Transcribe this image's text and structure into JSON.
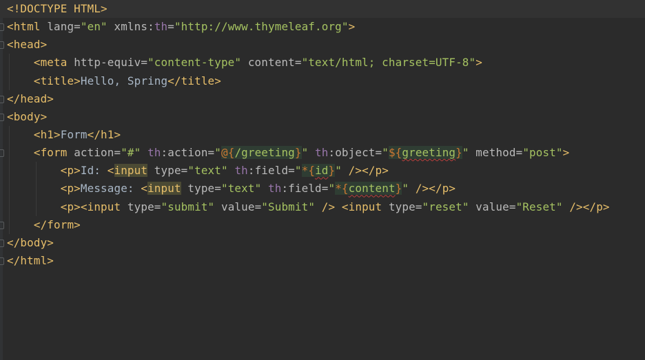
{
  "editor": {
    "lines": [
      {
        "indent": 0,
        "fold": false,
        "tokens": [
          [
            "<!DOCTYPE HTML>",
            "tag"
          ]
        ]
      },
      {
        "indent": 0,
        "fold": true,
        "tokens": [
          [
            "<html ",
            "tag"
          ],
          [
            "lang=",
            "attr"
          ],
          [
            "\"en\"",
            "str"
          ],
          [
            " xmlns:",
            "attr"
          ],
          [
            "th",
            "ns"
          ],
          [
            "=",
            "attr"
          ],
          [
            "\"http://www.thymeleaf.org\"",
            "str"
          ],
          [
            ">",
            "tag"
          ]
        ]
      },
      {
        "indent": 0,
        "fold": true,
        "tokens": [
          [
            "<head>",
            "tag"
          ]
        ]
      },
      {
        "indent": 4,
        "fold": false,
        "tokens": [
          [
            "<meta ",
            "tag"
          ],
          [
            "http-equiv=",
            "attr"
          ],
          [
            "\"content-type\"",
            "str"
          ],
          [
            " content=",
            "attr"
          ],
          [
            "\"text/html; charset=UTF-8\"",
            "str"
          ],
          [
            ">",
            "tag"
          ]
        ]
      },
      {
        "indent": 4,
        "fold": false,
        "tokens": [
          [
            "<title>",
            "tag"
          ],
          [
            "Hello, Spring",
            "txt"
          ],
          [
            "</title>",
            "tag"
          ]
        ]
      },
      {
        "indent": 0,
        "fold": true,
        "tokens": [
          [
            "</head>",
            "tag"
          ]
        ]
      },
      {
        "indent": 0,
        "fold": true,
        "tokens": [
          [
            "<body>",
            "tag"
          ]
        ]
      },
      {
        "indent": 4,
        "fold": false,
        "tokens": [
          [
            "<h1>",
            "tag"
          ],
          [
            "Form",
            "txt"
          ],
          [
            "</h1>",
            "tag"
          ]
        ]
      },
      {
        "indent": 4,
        "fold": true,
        "tokens": [
          [
            "<form ",
            "tag"
          ],
          [
            "action=",
            "attr"
          ],
          [
            "\"#\"",
            "str"
          ],
          [
            " ",
            "attr"
          ],
          [
            "th",
            "ns"
          ],
          [
            ":action=",
            "attr"
          ],
          [
            "\"",
            "str"
          ],
          [
            "@{",
            "exp expbg"
          ],
          [
            "/greeting",
            "str expbg"
          ],
          [
            "}",
            "exp expbg"
          ],
          [
            "\"",
            "str"
          ],
          [
            " ",
            "attr"
          ],
          [
            "th",
            "ns"
          ],
          [
            ":object=",
            "attr"
          ],
          [
            "\"",
            "str"
          ],
          [
            "${",
            "exp expbg"
          ],
          [
            "greeting",
            "str expbg err"
          ],
          [
            "}",
            "exp expbg"
          ],
          [
            "\"",
            "str"
          ],
          [
            " method=",
            "attr"
          ],
          [
            "\"post\"",
            "str"
          ],
          [
            ">",
            "tag"
          ]
        ]
      },
      {
        "indent": 8,
        "fold": false,
        "tokens": [
          [
            "<p>",
            "tag"
          ],
          [
            "Id: ",
            "txt"
          ],
          [
            "<",
            "tag"
          ],
          [
            "input",
            "tag hl"
          ],
          [
            " type=",
            "attr"
          ],
          [
            "\"text\"",
            "str"
          ],
          [
            " ",
            "attr"
          ],
          [
            "th",
            "ns"
          ],
          [
            ":field=",
            "attr"
          ],
          [
            "\"",
            "str"
          ],
          [
            "*{",
            "exp expbg"
          ],
          [
            "id",
            "str expbg err"
          ],
          [
            "}",
            "exp expbg"
          ],
          [
            "\"",
            "str"
          ],
          [
            " />",
            "tag"
          ],
          [
            "</p>",
            "tag"
          ]
        ]
      },
      {
        "indent": 8,
        "fold": false,
        "tokens": [
          [
            "<p>",
            "tag"
          ],
          [
            "Message: ",
            "txt"
          ],
          [
            "<",
            "tag"
          ],
          [
            "input",
            "tag hl"
          ],
          [
            " type=",
            "attr"
          ],
          [
            "\"text\"",
            "str"
          ],
          [
            " ",
            "attr"
          ],
          [
            "th",
            "ns"
          ],
          [
            ":field=",
            "attr"
          ],
          [
            "\"",
            "str"
          ],
          [
            "*{",
            "exp expbg"
          ],
          [
            "content",
            "str expbg err"
          ],
          [
            "}",
            "exp expbg"
          ],
          [
            "\"",
            "str"
          ],
          [
            " />",
            "tag"
          ],
          [
            "</p>",
            "tag"
          ]
        ]
      },
      {
        "indent": 8,
        "fold": false,
        "tokens": [
          [
            "<p><input ",
            "tag"
          ],
          [
            "type=",
            "attr"
          ],
          [
            "\"submit\"",
            "str"
          ],
          [
            " value=",
            "attr"
          ],
          [
            "\"Submit\"",
            "str"
          ],
          [
            " /> <input ",
            "tag"
          ],
          [
            "type=",
            "attr"
          ],
          [
            "\"reset\"",
            "str"
          ],
          [
            " value=",
            "attr"
          ],
          [
            "\"Reset\"",
            "str"
          ],
          [
            " /></p>",
            "tag"
          ]
        ]
      },
      {
        "indent": 4,
        "fold": true,
        "tokens": [
          [
            "</form>",
            "tag"
          ]
        ]
      },
      {
        "indent": 0,
        "fold": true,
        "tokens": [
          [
            "</body>",
            "tag"
          ]
        ]
      },
      {
        "indent": 0,
        "fold": true,
        "tokens": [
          [
            "</html>",
            "tag"
          ]
        ]
      }
    ]
  }
}
